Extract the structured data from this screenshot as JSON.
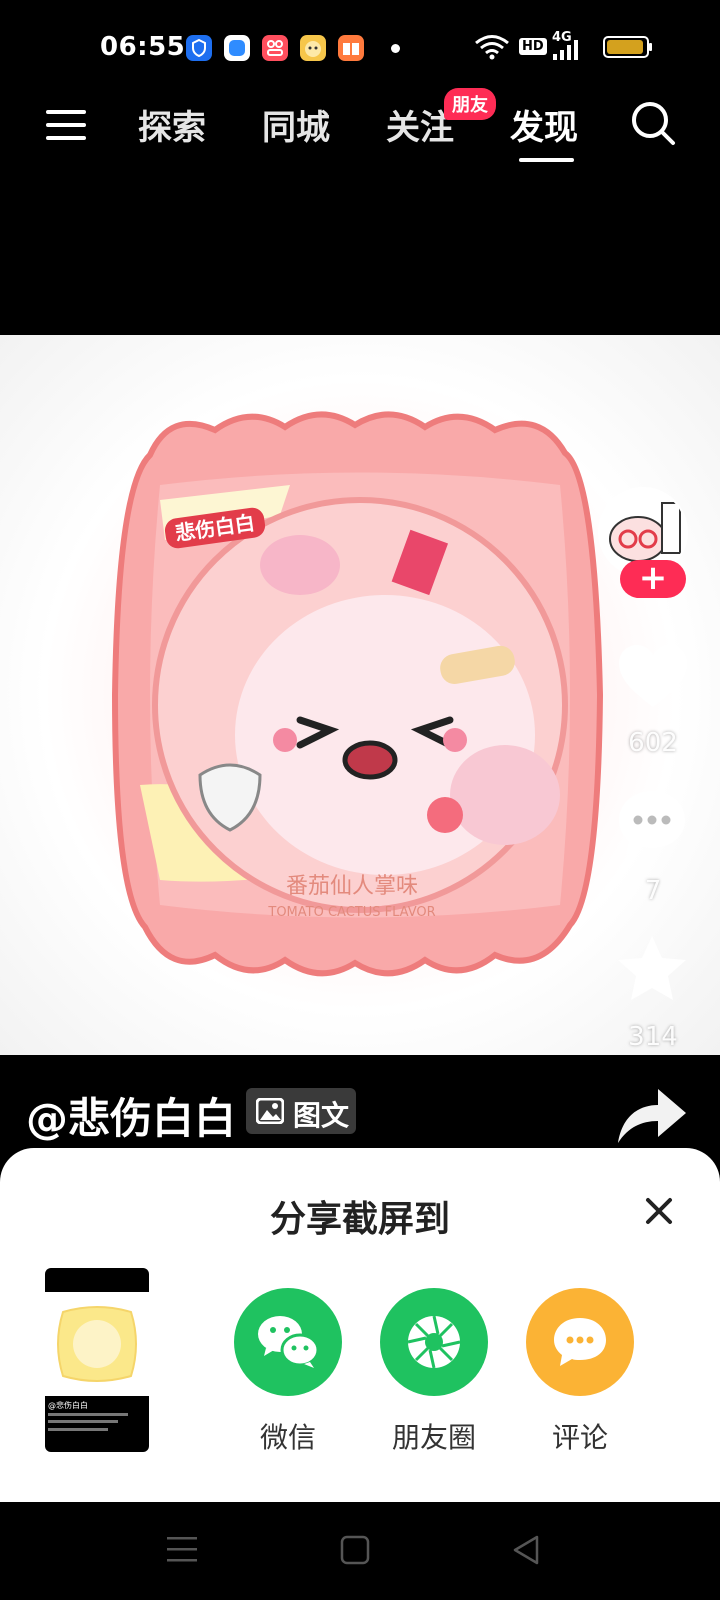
{
  "status_bar": {
    "time": "06:55",
    "hd_label": "HD",
    "network_label": "4G",
    "app_icons": [
      "shield-app-icon",
      "blue-app-icon",
      "red-app-icon",
      "game-app-icon",
      "book-app-icon"
    ]
  },
  "top_nav": {
    "menu_icon": "menu-icon",
    "tabs": [
      {
        "label": "探索"
      },
      {
        "label": "同城"
      },
      {
        "label": "关注"
      },
      {
        "label": "发现"
      }
    ],
    "active_tab": "发现",
    "friends_badge": "朋友",
    "search_icon": "search-icon"
  },
  "post": {
    "image_text": "番茄仙人掌味",
    "image_text_en": "TOMATO CACTUS FLAVOR",
    "image_label": "悲伤白白",
    "like_count": "602",
    "comment_count": "7",
    "favorite_count": "314",
    "author": "@悲伤白白",
    "content_type_tag": "图文"
  },
  "share_sheet": {
    "title": "分享截屏到",
    "targets": [
      {
        "label": "微信",
        "color": "#1fc260"
      },
      {
        "label": "朋友圈",
        "color": "#1fc260"
      },
      {
        "label": "评论",
        "color": "#fbb335"
      }
    ],
    "thumbnail_author": "@悲伤白白"
  },
  "colors": {
    "accent": "#fe2c55",
    "wechat": "#1fc260",
    "comment": "#fbb335"
  }
}
